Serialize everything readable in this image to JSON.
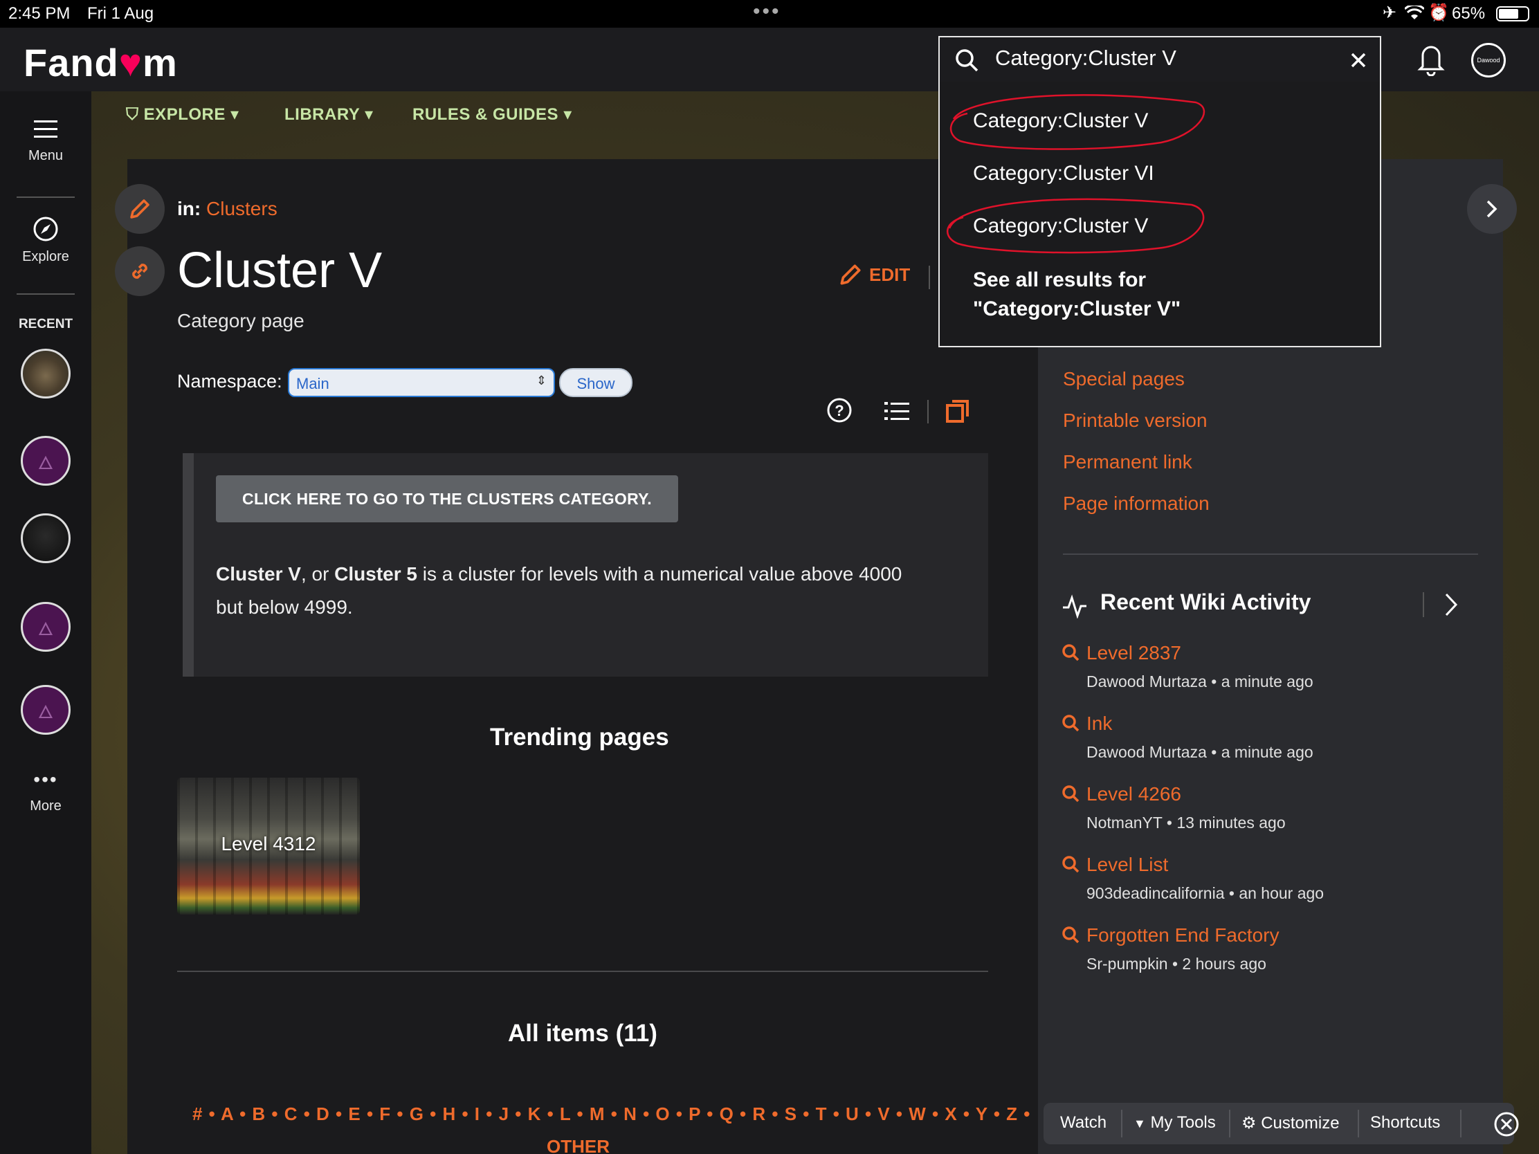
{
  "status_bar": {
    "time": "2:45 PM",
    "date": "Fri 1 Aug",
    "battery": "65%"
  },
  "header": {
    "logo_text": "Fandom",
    "avatar_label": "Dawood"
  },
  "nav": {
    "explore": "EXPLORE",
    "library": "LIBRARY",
    "rules": "RULES & GUIDES"
  },
  "rail": {
    "menu": "Menu",
    "explore": "Explore",
    "recent": "RECENT",
    "more": "More"
  },
  "search": {
    "query": "Category:Cluster V",
    "suggestions": [
      "Category:Cluster V",
      "Category:Cluster VI",
      "Category:Cluster V"
    ],
    "see_all_line1": "See all results for",
    "see_all_line2": "\"Category:Cluster V\""
  },
  "page": {
    "in_label": "in:",
    "category_link": "Clusters",
    "title": "Cluster V",
    "subtitle": "Category page",
    "edit_label": "EDIT",
    "namespace_label": "Namespace:",
    "namespace_value": "Main",
    "show_label": "Show",
    "go_button": "CLICK HERE TO GO TO THE CLUSTERS CATEGORY.",
    "desc_b1": "Cluster V",
    "desc_t1": ", or ",
    "desc_b2": "Cluster 5",
    "desc_t2": " is a cluster for levels with a numerical value above 4000",
    "desc_line2": "but below 4999.",
    "trending_heading": "Trending pages",
    "trending_card": "Level 4312",
    "all_items": "All items (11)",
    "alphabet": "# • A • B • C • D • E • F • G • H • I • J • K • L • M • N • O • P • Q • R • S • T • U • V • W • X • Y • Z •",
    "other": "OTHER"
  },
  "sidebar": {
    "links": [
      "Special pages",
      "Printable version",
      "Permanent link",
      "Page information"
    ],
    "activity_title": "Recent Wiki Activity",
    "activity": [
      {
        "title": "Level 2837",
        "meta": "Dawood Murtaza • a minute ago"
      },
      {
        "title": "Ink",
        "meta": "Dawood Murtaza • a minute ago"
      },
      {
        "title": "Level 4266",
        "meta": "NotmanYT • 13 minutes ago"
      },
      {
        "title": "Level List",
        "meta": "903deadincalifornia • an hour ago"
      },
      {
        "title": "Forgotten End Factory",
        "meta": "Sr-pumpkin • 2 hours ago"
      }
    ]
  },
  "toolbar": {
    "watch": "Watch",
    "my_tools": "My Tools",
    "customize": "Customize",
    "shortcuts": "Shortcuts"
  },
  "colors": {
    "accent": "#ef6b2c",
    "nav_green": "#c7e6a6",
    "annotation_red": "#e0122a"
  }
}
